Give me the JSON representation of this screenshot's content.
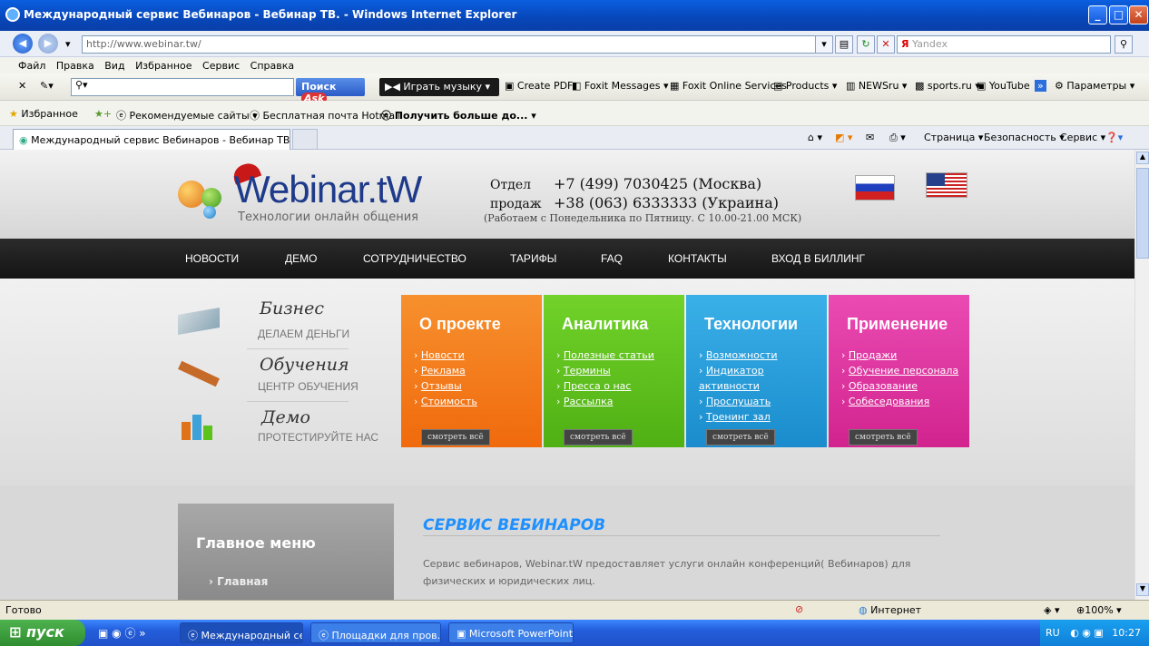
{
  "window": {
    "title": "Международный сервис Вебинаров - Вебинар ТВ. - Windows Internet Explorer"
  },
  "address": {
    "url": "http://www.webinar.tw/",
    "search_placeholder": "Yandex"
  },
  "menu": [
    "Файл",
    "Правка",
    "Вид",
    "Избранное",
    "Сервис",
    "Справка"
  ],
  "toolbar": {
    "search_btn": "Поиск",
    "music": "Играть музыку",
    "items": [
      "Create PDF",
      "Foxit Messages ▾",
      "Foxit Online Services",
      "Products ▾",
      "NEWSru ▾",
      "sports.ru ▾",
      "YouTube",
      "Параметры ▾"
    ]
  },
  "favbar": {
    "favorites": "Избранное",
    "items": [
      "Рекомендуемые сайты ▾",
      "Бесплатная почта Hotmail",
      "Получить больше до..."
    ]
  },
  "tab": {
    "title": "Международный сервис Вебинаров - Вебинар ТВ.",
    "cmd": [
      "Страница ▾",
      "Безопасность ▾",
      "Сервис ▾"
    ]
  },
  "site": {
    "logo": "Webinar.tW",
    "logo_sub": "Технологии онлайн общения",
    "phone_label1": "Отдел",
    "phone_label2": "продаж",
    "phone1": "+7 (499) 7030425 (Москва)",
    "phone2": "+38 (063) 6333333 (Украина)",
    "hours": "(Работаем с Понедельника по Пятницу. С 10.00-21.00 МСК)",
    "nav": [
      "НОВОСТИ",
      "ДЕМО",
      "СОТРУДНИЧЕСТВО",
      "ТАРИФЫ",
      "FAQ",
      "КОНТАКТЫ",
      "ВХОД В БИЛЛИНГ"
    ],
    "left": [
      {
        "title": "Бизнес",
        "sub": "ДЕЛАЕМ ДЕНЬГИ"
      },
      {
        "title": "Обучения",
        "sub": "ЦЕНТР ОБУЧЕНИЯ"
      },
      {
        "title": "Демо",
        "sub": "ПРОТЕСТИРУЙТЕ НАС"
      }
    ],
    "boxes": [
      {
        "title": "О проекте",
        "color": "#f26b0f",
        "links": [
          "Новости",
          "Реклама",
          "Отзывы",
          "Стоимость"
        ]
      },
      {
        "title": "Аналитика",
        "color": "#5cc21c",
        "links": [
          "Полезные статьи",
          "Термины",
          "Пресса о нас",
          "Рассылка"
        ]
      },
      {
        "title": "Технологии",
        "color": "#1f9ad9",
        "links": [
          "Возможности",
          "Индикатор активности",
          "Прослушать",
          "Тренинг зал"
        ]
      },
      {
        "title": "Применение",
        "color": "#df2fa0",
        "links": [
          "Продажи",
          "Обучение персонала",
          "Образование",
          "Собеседования"
        ]
      }
    ],
    "more": "смотреть всё",
    "main_menu": "Главное меню",
    "main_menu_item": "Главная",
    "service_title": "СЕРВИС ВЕБИНАРОВ",
    "service_text": "Сервис вебинаров, Webinar.tW предоставляет услуги онлайн конференций( Вебинаров) для физических и юридических лиц."
  },
  "status": {
    "left": "Готово",
    "zone": "Интернет",
    "zoom": "100%"
  },
  "taskbar": {
    "start": "пуск",
    "tasks": [
      "Международный се...",
      "Площадки для пров...",
      "Microsoft PowerPoint ..."
    ],
    "lang": "RU",
    "time": "10:27"
  }
}
